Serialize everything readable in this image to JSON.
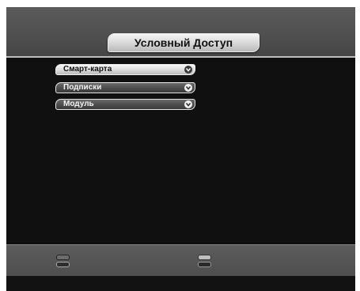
{
  "header": {
    "title": "Условный Доступ"
  },
  "menu": {
    "items": [
      {
        "label": "Смарт-карта",
        "state": "selected"
      },
      {
        "label": "Подписки",
        "state": "normal"
      },
      {
        "label": "Модуль",
        "state": "normal"
      }
    ]
  },
  "footer": {
    "buttons": [
      {
        "icon": "color-key-icon"
      },
      {
        "icon": "color-key-icon"
      }
    ]
  },
  "colors": {
    "background": "#101010",
    "header": "#555555",
    "selected_item": "#d8d8d8",
    "normal_item": "#4c4c4c"
  }
}
